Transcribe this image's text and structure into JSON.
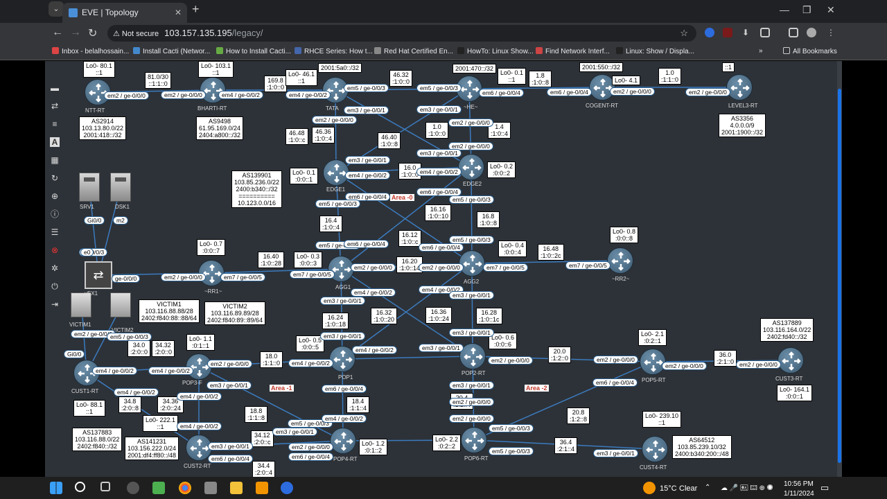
{
  "browser": {
    "tab_title": "EVE | Topology",
    "not_secure": "Not secure",
    "url_host": "103.157.135.195",
    "url_path": "/legacy/",
    "bookmarks": [
      "Inbox - belalhossain...",
      "Install Cacti (Networ...",
      "How to Install Cacti...",
      "RHCE Series: How t...",
      "Red Hat Certified En...",
      "HowTo: Linux Show...",
      "Find Network Interf...",
      "Linux: Show / Displa..."
    ],
    "all_bookmarks": "All Bookmarks"
  },
  "nodes": [
    {
      "id": "ntt",
      "label": "NTT-RT"
    },
    {
      "id": "bharti",
      "label": "BHARTI-RT"
    },
    {
      "id": "tata",
      "label": "TATA"
    },
    {
      "id": "he",
      "label": "~HE~"
    },
    {
      "id": "cogent",
      "label": "COGENT-RT"
    },
    {
      "id": "level3",
      "label": "LEVEL3-RT"
    },
    {
      "id": "edge1",
      "label": "EDGE1"
    },
    {
      "id": "edge2",
      "label": "EDGE2"
    },
    {
      "id": "srv1",
      "label": "SRV1"
    },
    {
      "id": "dsk1",
      "label": "DSK1"
    },
    {
      "id": "vex1",
      "label": "vEX1"
    },
    {
      "id": "rr1",
      "label": "~RR1~"
    },
    {
      "id": "agg1",
      "label": "AGG1"
    },
    {
      "id": "agg2",
      "label": "AGG2"
    },
    {
      "id": "rr2",
      "label": "~RR2~"
    },
    {
      "id": "victim1",
      "label": "VICTIM1"
    },
    {
      "id": "victim2",
      "label": "VICTIM2"
    },
    {
      "id": "cust1",
      "label": "CUST1-RT"
    },
    {
      "id": "pop3",
      "label": "POP3-F"
    },
    {
      "id": "pop1",
      "label": "POP1"
    },
    {
      "id": "pop2",
      "label": "POP2-RT"
    },
    {
      "id": "pop5",
      "label": "POP5-RT"
    },
    {
      "id": "cust3",
      "label": "CUST3-RT"
    },
    {
      "id": "pop4",
      "label": "POP4-RT"
    },
    {
      "id": "pop6",
      "label": "POP6-RT"
    },
    {
      "id": "cust2",
      "label": "CUST2-RT"
    },
    {
      "id": "cust4",
      "label": "CUST4-RT"
    }
  ],
  "boxes": [
    "Lo0- 80.1\n::1",
    "81.0/30\n::1:1::0",
    "Lo0- 103.1\n::1",
    "169.8\n:1:0::0",
    "Lo0- 46.1\n::1",
    "2001:5a0::/32",
    "46.32\n:1:0::0",
    "2001:470::/32",
    "Lo0- 0.1\n::1",
    "1.8\n:1:0::8",
    "2001:550::/32",
    "Lo0- 4.1",
    "1.0\n:1:1::0",
    "::1",
    "AS2914\n103.13.80.0/22\n2001:418::/32",
    "AS9498\n61.95.169.0/24\n2404:a800::/32",
    "AS3356\n4.0.0.0/9\n2001:1900::/32",
    "46.48\n:1:0::c",
    "46.36\n:1:0::4",
    "46.40\n:1:0::8",
    "1.0\n:1:0::0",
    "1.4\n:1:0::4",
    "Lo0- 0.1\n:0:0::1",
    "16.0\n:1:0::0",
    "Lo0- 0.2\n:0:0::2",
    "AS139901\n103.85.236.0/22\n2400:b340::/32\n==========\n10.123.0.0/16",
    "16.16\n:1:0::10",
    "16.4\n:1:0::4",
    "16.8\n:1:0::8",
    "16.12\n:1:0::c",
    "Lo0- 0.8\n:0:0::8",
    "Lo0- 0.7\n:0:0::7",
    "16.40\n:1:0::28",
    "Lo0- 0.3\n:0:0::3",
    "16.20\n:1:0::14",
    "Lo0- 0.4\n:0:0::4",
    "16.48\n:1:0::2c",
    "VICTIM1\n103.116.88.88/28\n2402:f840:88::88/64",
    "VICTIM2\n103.116.89.89/28\n2402:f840:89::89/64",
    "16.32\n:1:0::20",
    "16.36\n:1:0::24",
    "16.28\n:1:0::1c",
    "16.24\n:1:0::18",
    "AS137889\n103.116.164.0/22\n2402:fd40::/32",
    "Lo0- 1.1\n:0:1::1",
    "Lo0- 0.5\n:0:0::5",
    "Lo0- 0.6\n:0:0::6",
    "20.0\n:1:2::0",
    "Lo0- 2.1\n:0:2::1",
    "36.0\n:2:1::0",
    "34.0\n:2:0::0",
    "34.32\n:2:0::0",
    "18.0\n:1:1::0",
    "Lo0- 164.1\n:0:0::1",
    "34.8\n:2:0::8",
    "34.36\n:2:0::24",
    "Lo0- 88.1\n::1",
    "Lo0- 222.1\n::1",
    "18.4\n:1:1::4",
    "20.4\n:1:2::4",
    "20.8\n:1:2::8",
    "AS137883\n103.116.88.0/22\n2402:f840::/32",
    "AS141231\n103.156.222.0/24\n2001:df4:ff80::/48",
    "18.8\n:1:1::8",
    "34.12\n:2:0::c",
    "Lo0- 1.2\n:0:1::2",
    "Lo0- 2.2\n:0:2::2",
    "36.4\n:2:1::4",
    "Lo0- 239.10\n::1",
    "AS64512\n103.85.239.10/32\n2400:b340:200::/48",
    "34.4\n:2:0::4"
  ],
  "ports": [
    "em2 / ge-0/0/0",
    "em2 / ge-0/0/0",
    "em4 / ge-0/0/2",
    "em4 / ge-0/0/2",
    "em5 / ge-0/0/3",
    "em5 / ge-0/0/3",
    "em6 / ge-0/0/4",
    "em6 / ge-0/0/4",
    "em2 / ge-0/0/0",
    "em2 / ge-0/0/0",
    "em3 / ge-0/0/1",
    "em3 / ge-0/0/1",
    "em2 / ge-0/0/0",
    "em2 / ge-0/0/0",
    "em2 / ge-0/0/0",
    "em3 / ge-0/0/1",
    "em3 / ge-0/0/1",
    "em4 / ge-0/0/2",
    "em4 / ge-0/0/2",
    "em6 / ge-0/0/4",
    "em6 / ge-0/0/4",
    "em5 / ge-0/0/3",
    "em5 / ge-0/0/3",
    "ge-0/0/3",
    "ge-0/0/0",
    "em2 / ge-0/0/0",
    "em7 / ge-0/0/5",
    "em7 / ge-0/0/5",
    "em2 / ge-0/0/0",
    "em6 / ge-0/0/4",
    "em5 / ge-0/0/3",
    "em5 / ge-0/0/3",
    "em6 / ge-0/0/4",
    "em2 / ge-0/0/0",
    "em7 / ge-0/0/5",
    "em7 / ge-0/0/5",
    "em4 / ge-0/0/2",
    "em4 / ge-0/0/2",
    "em3 / ge-0/0/1",
    "em3 / ge-0/0/1",
    "em3 / ge-0/0/1",
    "em3 / ge-0/0/1",
    "em3 / ge-0/0/1",
    "em4 / ge-0/0/2",
    "em4 / ge-0/0/2",
    "em2 / ge-0/0/0",
    "em3 / ge-0/0/1",
    "em2 / ge-0/0/0",
    "em4 / ge-0/0/2",
    "em4 / ge-0/0/2",
    "em2 / ge-0/0/0",
    "em2 / ge-0/0/0",
    "em2 / ge-0/0/0",
    "em4 / ge-0/0/2",
    "em4 / ge-0/0/2",
    "em6 / ge-0/0/4",
    "em6 / ge-0/0/4",
    "em3 / ge-0/0/1",
    "em5 / ge-0/0/3",
    "em5 / ge-0/0/3",
    "em3 / ge-0/0/1",
    "em3 / ge-0/0/1",
    "em6 / ge-0/0/4",
    "em4 / ge-0/0/2",
    "em2 / ge-0/0/0",
    "em6 / ge-0/0/4",
    "em4 / ge-0/0/2",
    "em2 / ge-0/0/0",
    "em5 / ge-0/0/3",
    "em3 / ge-0/0/1",
    "em2 / ge-0/0/0",
    "em2 / ge-0/0/0",
    "em5 / ge-0/0/3",
    "Gi0/0",
    "Gi0/0",
    "m2",
    "e0",
    "e0",
    "ge-0/"
  ],
  "areas": [
    "Area -0",
    "Area -1",
    "Area -2"
  ],
  "taskbar": {
    "weather": "15°C",
    "condition": "Clear",
    "time": "10:56 PM",
    "date": "1/11/2024"
  },
  "colors": {
    "canvas": "#2d3238",
    "link": "#3b7bbf",
    "accent": "#1a73e8"
  }
}
